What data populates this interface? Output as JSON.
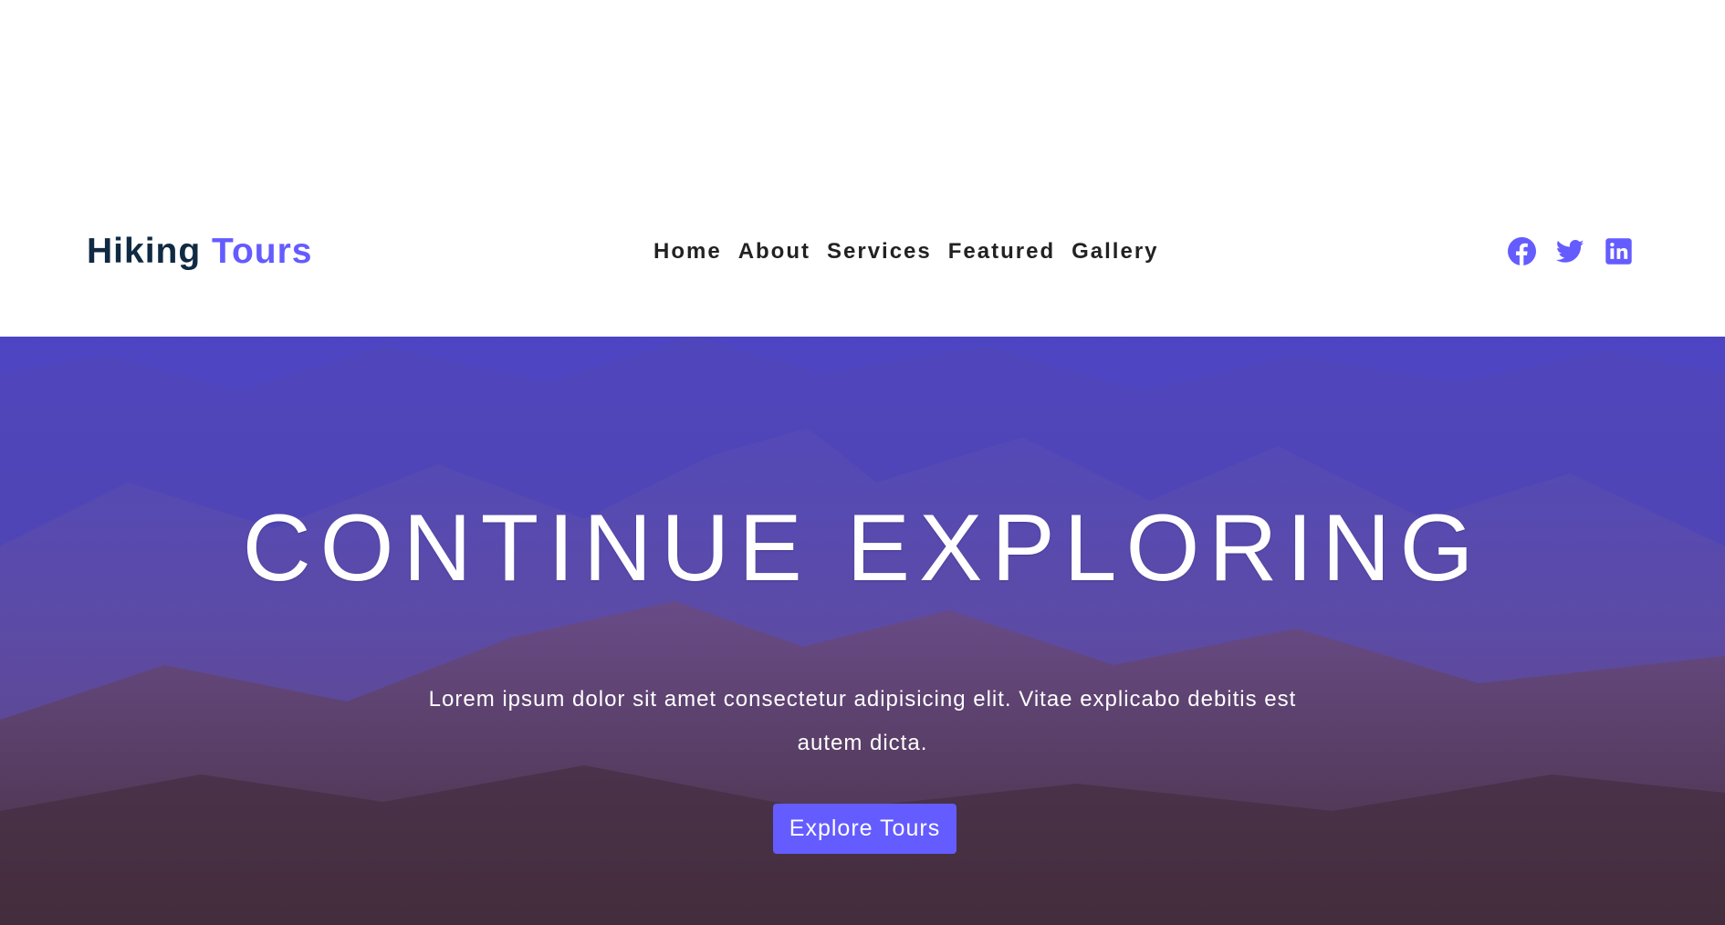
{
  "navbar": {
    "brand_main": "Hiking ",
    "brand_accent": "Tours",
    "links": [
      "Home",
      "About",
      "Services",
      "Featured",
      "Gallery"
    ],
    "socials": [
      "facebook-icon",
      "twitter-icon",
      "linkedin-icon"
    ]
  },
  "hero": {
    "title": "CONTINUE EXPLORING",
    "text": "Lorem ipsum dolor sit amet consectetur adipisicing elit. Vitae explicabo debitis est autem dicta.",
    "button_label": "Explore Tours"
  },
  "colors": {
    "accent": "#645cff",
    "heading": "#102a43",
    "nav_text": "#222222"
  }
}
